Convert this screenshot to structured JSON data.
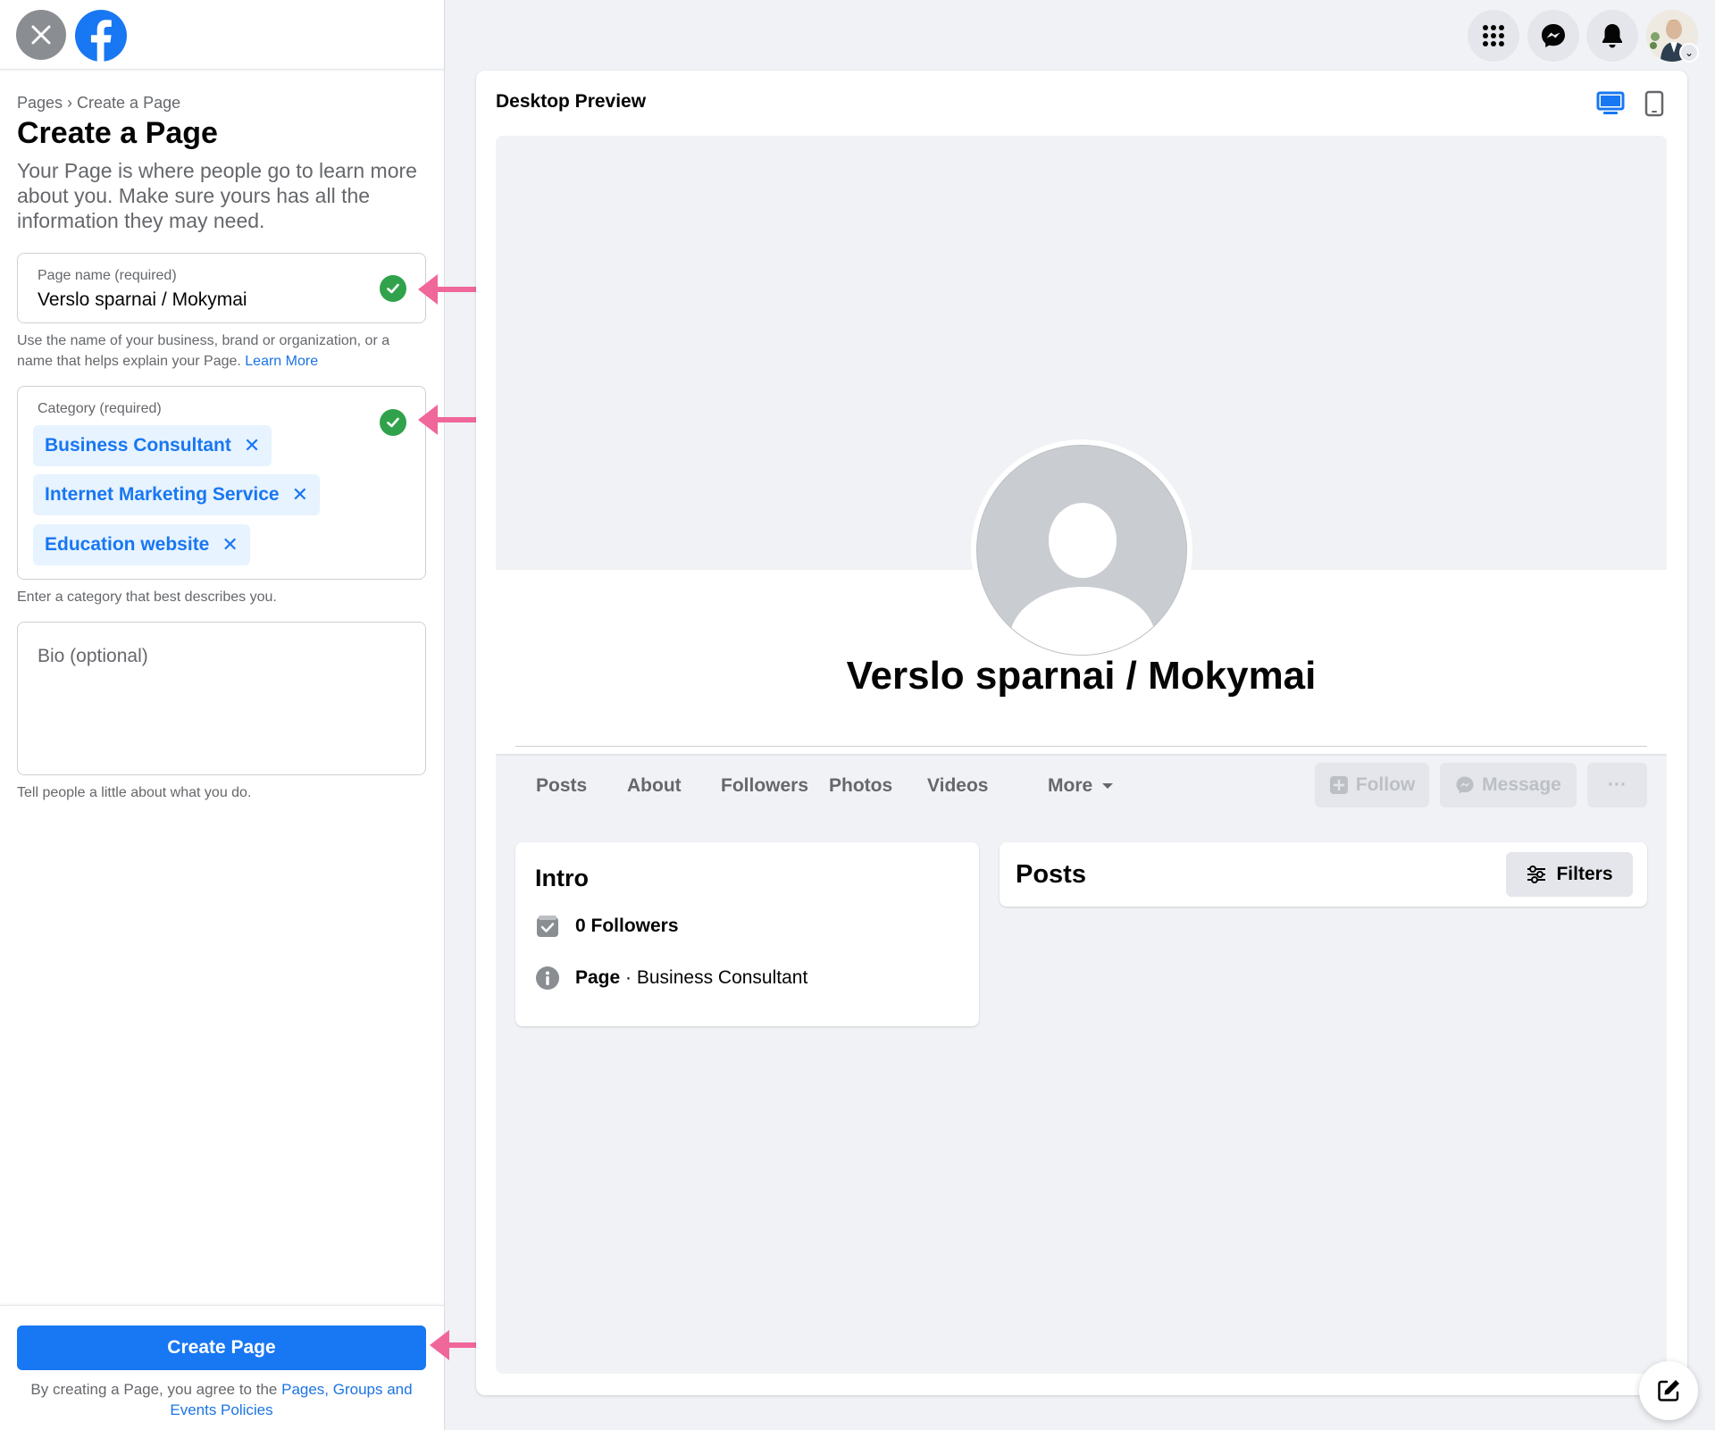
{
  "sidebar": {
    "breadcrumb": "Pages › Create a Page",
    "title": "Create a Page",
    "description": "Your Page is where people go to learn more about you. Make sure yours has all the information they may need.",
    "page_name": {
      "label": "Page name (required)",
      "value": "Verslo sparnai / Mokymai",
      "help": "Use the name of your business, brand or organization, or a name that helps explain your Page.",
      "help_link": "Learn More"
    },
    "category": {
      "label": "Category (required)",
      "chips": [
        "Business Consultant",
        "Internet Marketing Service",
        "Education website"
      ],
      "help": "Enter a category that best describes you."
    },
    "bio": {
      "placeholder": "Bio (optional)",
      "help": "Tell people a little about what you do."
    },
    "create_button": "Create Page",
    "terms_prefix": "By creating a Page, you agree to the",
    "terms_link": "Pages, Groups and Events Policies"
  },
  "nav": {
    "icons": [
      "apps-grid-icon",
      "messenger-icon",
      "bell-icon",
      "account-avatar"
    ]
  },
  "preview": {
    "title": "Desktop Preview",
    "device_icons": [
      "desktop-icon",
      "mobile-icon"
    ],
    "page_name": "Verslo sparnai / Mokymai",
    "tabs": [
      "Posts",
      "About",
      "Followers",
      "Photos",
      "Videos",
      "More"
    ],
    "actions": {
      "follow": "Follow",
      "message": "Message",
      "more": "···"
    },
    "intro": {
      "title": "Intro",
      "followers": "0 Followers",
      "page_type_bold": "Page",
      "page_type_rest": " · Business Consultant"
    },
    "posts": {
      "title": "Posts",
      "filters": "Filters"
    }
  },
  "colors": {
    "brand_blue": "#1877f2",
    "check_green": "#31a24c",
    "annotation_arrow": "#f0679a"
  }
}
